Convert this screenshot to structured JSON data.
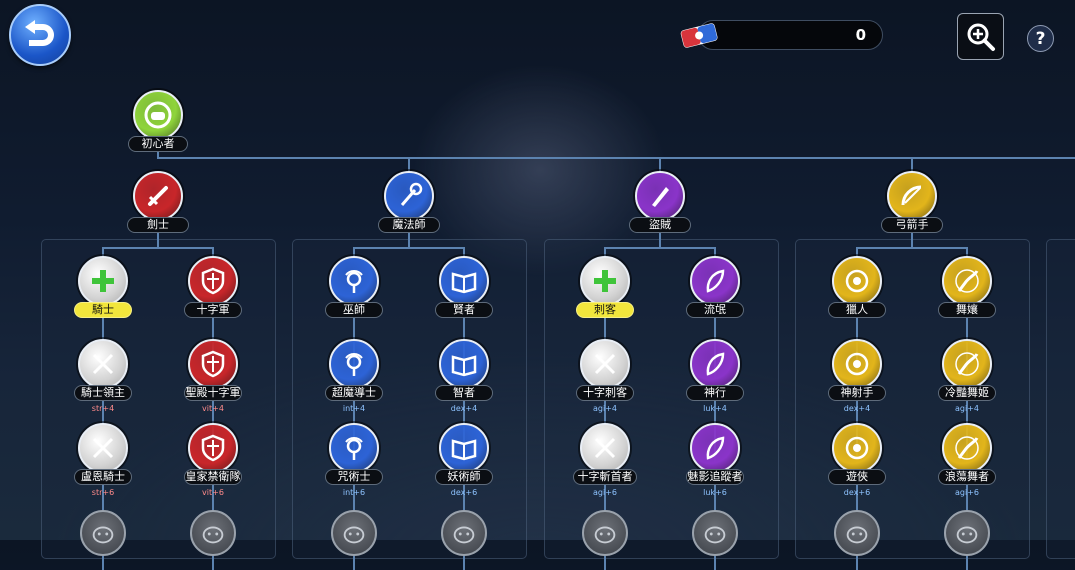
{
  "top_bar": {
    "currency_value": "0"
  },
  "root": {
    "label": "初心者"
  },
  "branches": [
    {
      "label": "劍士",
      "color": "#c8262a",
      "subs": [
        {
          "label": "騎士",
          "color": "#d6d6d6",
          "highlight": true,
          "tiers": [
            {
              "label": "騎士領主",
              "stat": "str+4"
            },
            {
              "label": "盧恩騎士",
              "stat": "str+6"
            }
          ]
        },
        {
          "label": "十字軍",
          "color": "#c8262a",
          "highlight": false,
          "tiers": [
            {
              "label": "聖殿十字軍",
              "stat": "vit+4"
            },
            {
              "label": "皇家禁衛隊",
              "stat": "vit+6"
            }
          ]
        }
      ]
    },
    {
      "label": "魔法師",
      "color": "#2d63d6",
      "subs": [
        {
          "label": "巫師",
          "color": "#2d63d6",
          "highlight": false,
          "tiers": [
            {
              "label": "超魔導士",
              "stat": "int+4"
            },
            {
              "label": "咒術士",
              "stat": "int+6"
            }
          ]
        },
        {
          "label": "賢者",
          "color": "#2d63d6",
          "highlight": false,
          "tiers": [
            {
              "label": "智者",
              "stat": "dex+4"
            },
            {
              "label": "妖術師",
              "stat": "dex+6"
            }
          ]
        }
      ]
    },
    {
      "label": "盜賊",
      "color": "#8a34c9",
      "subs": [
        {
          "label": "刺客",
          "color": "#d6d6d6",
          "highlight": true,
          "tiers": [
            {
              "label": "十字刺客",
              "stat": "agi+4"
            },
            {
              "label": "十字斬首者",
              "stat": "agi+6"
            }
          ]
        },
        {
          "label": "流氓",
          "color": "#8a34c9",
          "highlight": false,
          "tiers": [
            {
              "label": "神行",
              "stat": "luk+4"
            },
            {
              "label": "魅影追蹤者",
              "stat": "luk+6"
            }
          ]
        }
      ]
    },
    {
      "label": "弓箭手",
      "color": "#e2b51b",
      "subs": [
        {
          "label": "獵人",
          "color": "#e2b51b",
          "highlight": false,
          "tiers": [
            {
              "label": "神射手",
              "stat": "dex+4"
            },
            {
              "label": "遊俠",
              "stat": "dex+6"
            }
          ]
        },
        {
          "label": "舞孃",
          "color": "#e2b51b",
          "highlight": false,
          "tiers": [
            {
              "label": "冷豔舞姬",
              "stat": "agi+4"
            },
            {
              "label": "浪蕩舞者",
              "stat": "agi+6"
            }
          ]
        }
      ]
    }
  ],
  "icons": {
    "back": "back-arrow-icon",
    "ticket": "ticket-icon",
    "zoom": "zoom-in-icon",
    "help": "help-icon"
  },
  "help_symbol": "?"
}
